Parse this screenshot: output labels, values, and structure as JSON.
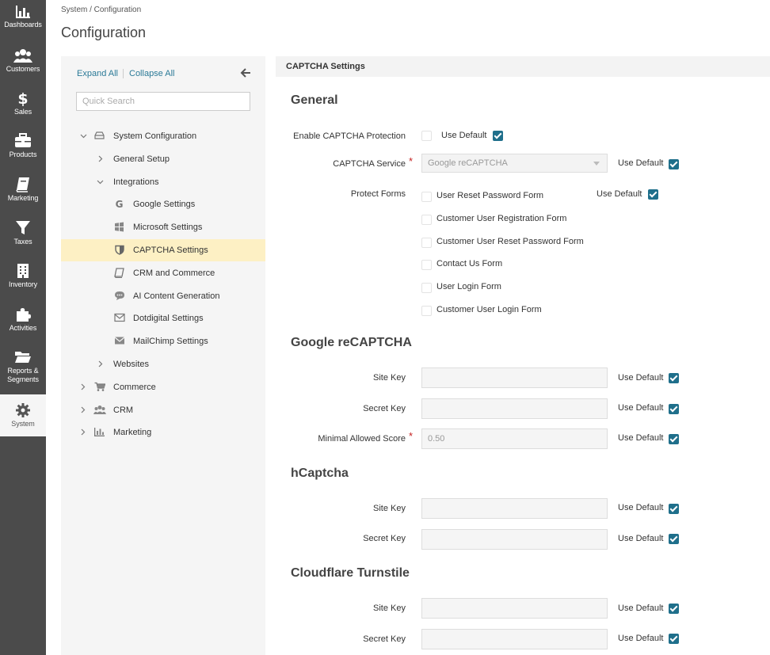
{
  "nav": [
    {
      "label": "Dashboards",
      "icon": "dashboards-icon"
    },
    {
      "label": "Customers",
      "icon": "customers-icon"
    },
    {
      "label": "Sales",
      "icon": "dollar-icon"
    },
    {
      "label": "Products",
      "icon": "briefcase-icon"
    },
    {
      "label": "Marketing",
      "icon": "book-icon"
    },
    {
      "label": "Taxes",
      "icon": "filter-icon"
    },
    {
      "label": "Inventory",
      "icon": "building-icon"
    },
    {
      "label": "Activities",
      "icon": "puzzle-icon"
    },
    {
      "label": "Reports &",
      "label2": "Segments",
      "icon": "folder-icon"
    },
    {
      "label": "System",
      "icon": "gear-icon"
    }
  ],
  "breadcrumb": "System / Configuration",
  "page_title": "Configuration",
  "tree": {
    "expand_all": "Expand All",
    "collapse_all": "Collapse All",
    "search_placeholder": "Quick Search",
    "items": [
      {
        "label": "System Configuration",
        "icon": "server-icon"
      },
      {
        "label": "General Setup"
      },
      {
        "label": "Integrations"
      },
      {
        "label": "Google Settings",
        "icon": "google-icon"
      },
      {
        "label": "Microsoft Settings",
        "icon": "windows-icon"
      },
      {
        "label": "CAPTCHA Settings",
        "icon": "shield-icon"
      },
      {
        "label": "CRM and Commerce",
        "icon": "book-icon"
      },
      {
        "label": "AI Content Generation",
        "icon": "comment-icon"
      },
      {
        "label": "Dotdigital Settings",
        "icon": "envelope-outline-icon"
      },
      {
        "label": "MailChimp Settings",
        "icon": "envelope-icon"
      },
      {
        "label": "Websites"
      },
      {
        "label": "Commerce",
        "icon": "cart-icon"
      },
      {
        "label": "CRM",
        "icon": "users-icon"
      },
      {
        "label": "Marketing",
        "icon": "bar-chart-icon"
      }
    ]
  },
  "content": {
    "header": "CAPTCHA Settings",
    "use_default": "Use Default",
    "general": {
      "title": "General",
      "enable_label": "Enable CAPTCHA Protection",
      "service_label": "CAPTCHA Service",
      "service_value": "Google reCAPTCHA",
      "protect_label": "Protect Forms",
      "forms": [
        "User Reset Password Form",
        "Customer User Registration Form",
        "Customer User Reset Password Form",
        "Contact Us Form",
        "User Login Form",
        "Customer User Login Form"
      ]
    },
    "recaptcha": {
      "title": "Google reCAPTCHA",
      "site_key_label": "Site Key",
      "secret_key_label": "Secret Key",
      "score_label": "Minimal Allowed Score",
      "score_value": "0.50"
    },
    "hcaptcha": {
      "title": "hCaptcha",
      "site_key_label": "Site Key",
      "secret_key_label": "Secret Key"
    },
    "turnstile": {
      "title": "Cloudflare Turnstile",
      "site_key_label": "Site Key",
      "secret_key_label": "Secret Key"
    }
  }
}
